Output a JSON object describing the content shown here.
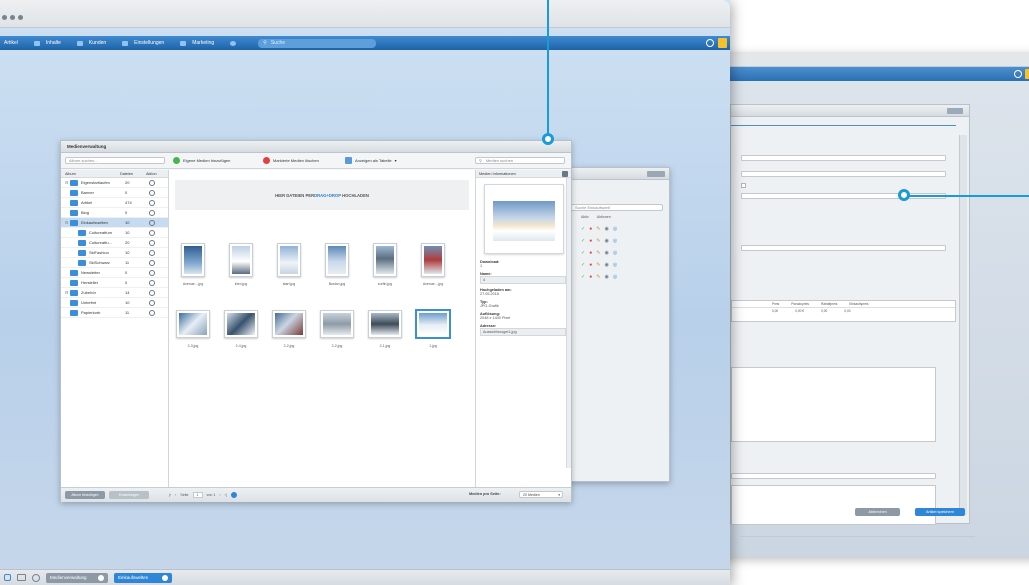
{
  "menu": {
    "items": [
      {
        "label": "Artikel",
        "icon": "article-icon"
      },
      {
        "label": "Inhalte",
        "icon": "content-icon"
      },
      {
        "label": "Kunden",
        "icon": "customers-icon"
      },
      {
        "label": "Einstellungen",
        "icon": "settings-icon"
      },
      {
        "label": "Marketing",
        "icon": "marketing-icon"
      }
    ],
    "search_label": "Suche"
  },
  "media_manager": {
    "title": "Medienverwaltung",
    "album_search_placeholder": "Album suchen...",
    "toolbar": {
      "add_label": "Eigene Medien hinzufügen",
      "delete_label": "Markierte Medien löschen",
      "view_label": "Anzeigen als Tabelle"
    },
    "media_search_placeholder": "Medien suchen",
    "album_columns": [
      "Album",
      "Dateien",
      "Aktion"
    ],
    "albums": [
      {
        "name": "Eigenstartlaufen",
        "count": "20",
        "indent": 0,
        "selected": false
      },
      {
        "name": "Banner",
        "count": "0",
        "indent": 0,
        "selected": false
      },
      {
        "name": "Artikel",
        "count": "474",
        "indent": 0,
        "selected": false
      },
      {
        "name": "Blog",
        "count": "0",
        "indent": 0,
        "selected": false
      },
      {
        "name": "Einkaufswelten",
        "count": "10",
        "indent": 0,
        "selected": true
      },
      {
        "name": "Cultureatfum",
        "count": "10",
        "indent": 1,
        "selected": false
      },
      {
        "name": "Cultureatfu...",
        "count": "20",
        "indent": 1,
        "selected": false
      },
      {
        "name": "SkiFashion",
        "count": "10",
        "indent": 1,
        "selected": false
      },
      {
        "name": "SkiSchwarz",
        "count": "11",
        "indent": 1,
        "selected": false
      },
      {
        "name": "Newsletter",
        "count": "0",
        "indent": 0,
        "selected": false
      },
      {
        "name": "Hersteller",
        "count": "0",
        "indent": 0,
        "selected": false
      },
      {
        "name": "Zubehör",
        "count": "14",
        "indent": 0,
        "selected": false
      },
      {
        "name": "Unbefmt",
        "count": "10",
        "indent": 0,
        "selected": false
      },
      {
        "name": "Papierkorb",
        "count": "11",
        "indent": 0,
        "selected": false
      }
    ],
    "dropzone_prefix": "HIER DATEIEN PER ",
    "dropzone_highlight": "DRAG+DROP",
    "dropzone_suffix": " HOCHLADEN",
    "thumbnails": [
      {
        "label": "Avenue....jpg"
      },
      {
        "label": "intro.jpg"
      },
      {
        "label": "start.jpg"
      },
      {
        "label": "Boston.jpg"
      },
      {
        "label": "surfin.jpg"
      },
      {
        "label": "Avenue....jpg"
      },
      {
        "label": "2-3.jpg"
      },
      {
        "label": "2-4.jpg"
      },
      {
        "label": "2-2.jpg"
      },
      {
        "label": "2-2.jpg"
      },
      {
        "label": "2-1.jpg"
      },
      {
        "label": "1.jpg"
      }
    ],
    "info": {
      "title": "Medien Informationen",
      "fields": [
        {
          "label": "Download:",
          "value": "1"
        },
        {
          "label": "Name:",
          "value": "4"
        },
        {
          "label": "Hochgeladen am:",
          "value": "27.05.2016"
        },
        {
          "label": "Typ:",
          "value": "JPG-Grafik"
        },
        {
          "label": "Auflösung:",
          "value": "2048 x 1440 Pixel"
        },
        {
          "label": "Adresse:",
          "value": "Aussichtsvogel1.jpg"
        }
      ]
    },
    "footer": {
      "add_album": "Album hinzufügen",
      "settings": "Einstellungen",
      "page_label": "Seite",
      "page": "1",
      "page_of": "von 1",
      "per_page_label": "Medien pro Seite:",
      "per_page_value": "20 Medien"
    }
  },
  "mid_panel": {
    "search_placeholder": "Suche Einkaufswelt",
    "columns": [
      "Aktiv",
      "Aktionen"
    ]
  },
  "back_window": {
    "table_columns": [
      "Preis",
      "Pseudopreis",
      "Rabattpreis",
      "Einkaufspreis"
    ],
    "row_values": [
      "0,00",
      "0,00 €",
      "0,00",
      "0,00"
    ],
    "buttons": {
      "cancel": "Abbrechen",
      "save": "Artikel speichern"
    }
  },
  "taskbar": {
    "items": [
      "Medienverwaltung",
      "Einkaufswelten"
    ]
  },
  "colors": {
    "menu_blue": "#2a73bb",
    "accent_callout": "#1a9ad6",
    "shopware_logo": "#1f9ad6"
  }
}
